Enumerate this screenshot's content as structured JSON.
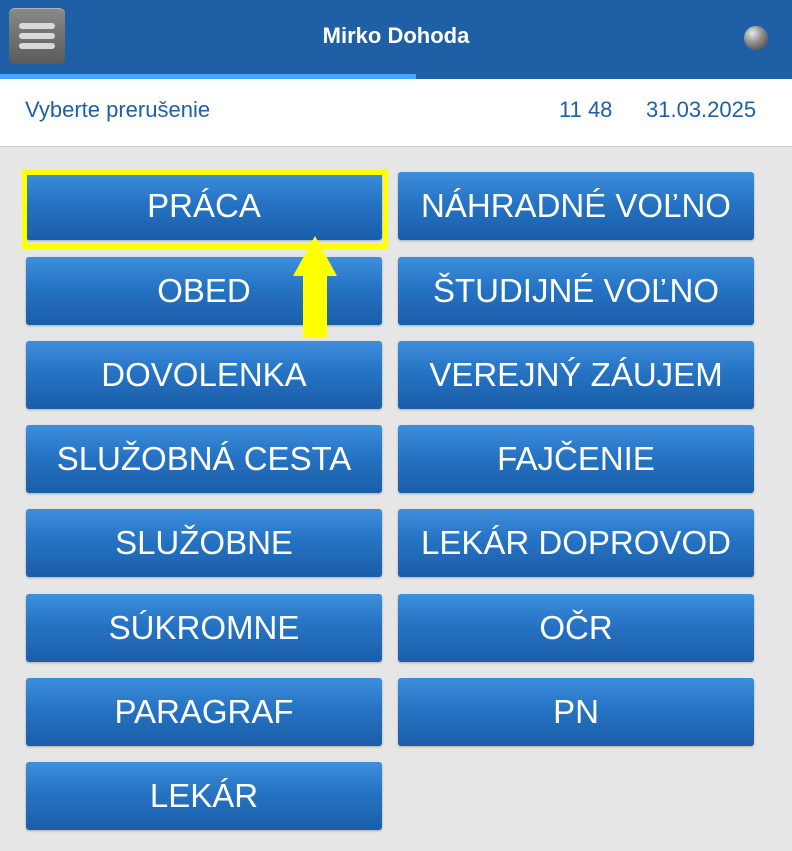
{
  "header": {
    "title": "Mirko Dohoda",
    "menu_icon": "hamburger-menu-icon",
    "status_icon": "status-dot-icon"
  },
  "progress": {
    "fraction": 0.525
  },
  "subheader": {
    "label": "Vyberte prerušenie",
    "time": "11 48",
    "date": "31.03.2025"
  },
  "buttons": {
    "col1": [
      "PRÁCA",
      "OBED",
      "DOVOLENKA",
      "SLUŽOBNÁ CESTA",
      "SLUŽOBNE",
      "SÚKROMNE",
      "PARAGRAF",
      "LEKÁR"
    ],
    "col2": [
      "NÁHRADNÉ VOĽNO",
      "ŠTUDIJNÉ VOĽNO",
      "VEREJNÝ ZÁUJEM",
      "FAJČENIE",
      "LEKÁR DOPROVOD",
      "OČR",
      "PN"
    ]
  },
  "annotation": {
    "highlight_color": "#ffff00",
    "arrow_color": "#ffff00"
  },
  "colors": {
    "header_bg": "#1f5fa5",
    "progress_fill": "#4aa3ff",
    "button_top": "#3d8fdc",
    "button_bottom": "#1a5ea8",
    "accent_text": "#1f5fa5"
  }
}
